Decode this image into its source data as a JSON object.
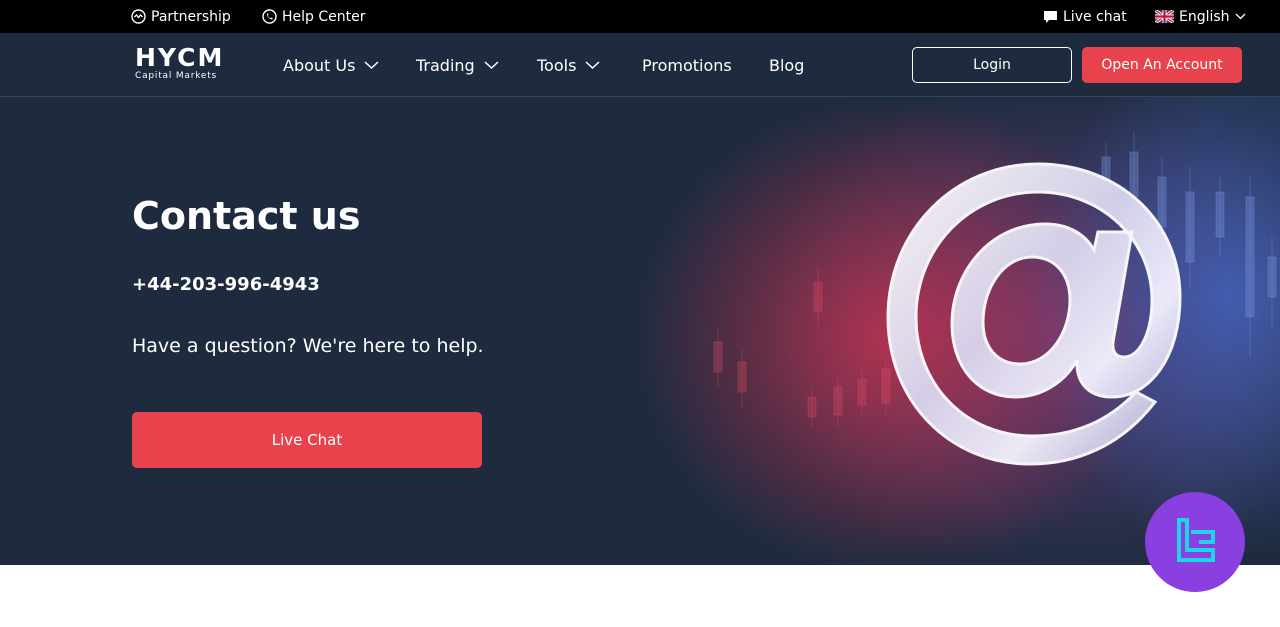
{
  "topbar": {
    "partnership": "Partnership",
    "help_center": "Help Center",
    "live_chat": "Live chat",
    "language": "English"
  },
  "nav": {
    "logo_mark": "HYCM",
    "logo_sub": "Capital Markets",
    "items": [
      {
        "label": "About Us",
        "has_dropdown": true
      },
      {
        "label": "Trading",
        "has_dropdown": true
      },
      {
        "label": "Tools",
        "has_dropdown": true
      },
      {
        "label": "Promotions",
        "has_dropdown": false
      },
      {
        "label": "Blog",
        "has_dropdown": false
      }
    ],
    "login_label": "Login",
    "open_account_label": "Open An Account"
  },
  "hero": {
    "title": "Contact us",
    "phone": "+44-203-996-4943",
    "subtitle": "Have a question? We're here to help.",
    "cta_label": "Live Chat"
  },
  "icons": {
    "partnership": "partnership-icon",
    "help_center": "phone-icon",
    "live_chat": "chat-bubble-icon",
    "language": "uk-flag-icon",
    "dropdown": "chevron-down-icon",
    "hero_art": "at-sign-icon",
    "badge": "tc-logo-icon"
  },
  "colors": {
    "topbar_bg": "#000000",
    "nav_bg": "#1e2b3f",
    "accent": "#e8434c",
    "badge": "#8a3fe0",
    "badge_glyph": "#1fd4e6"
  }
}
